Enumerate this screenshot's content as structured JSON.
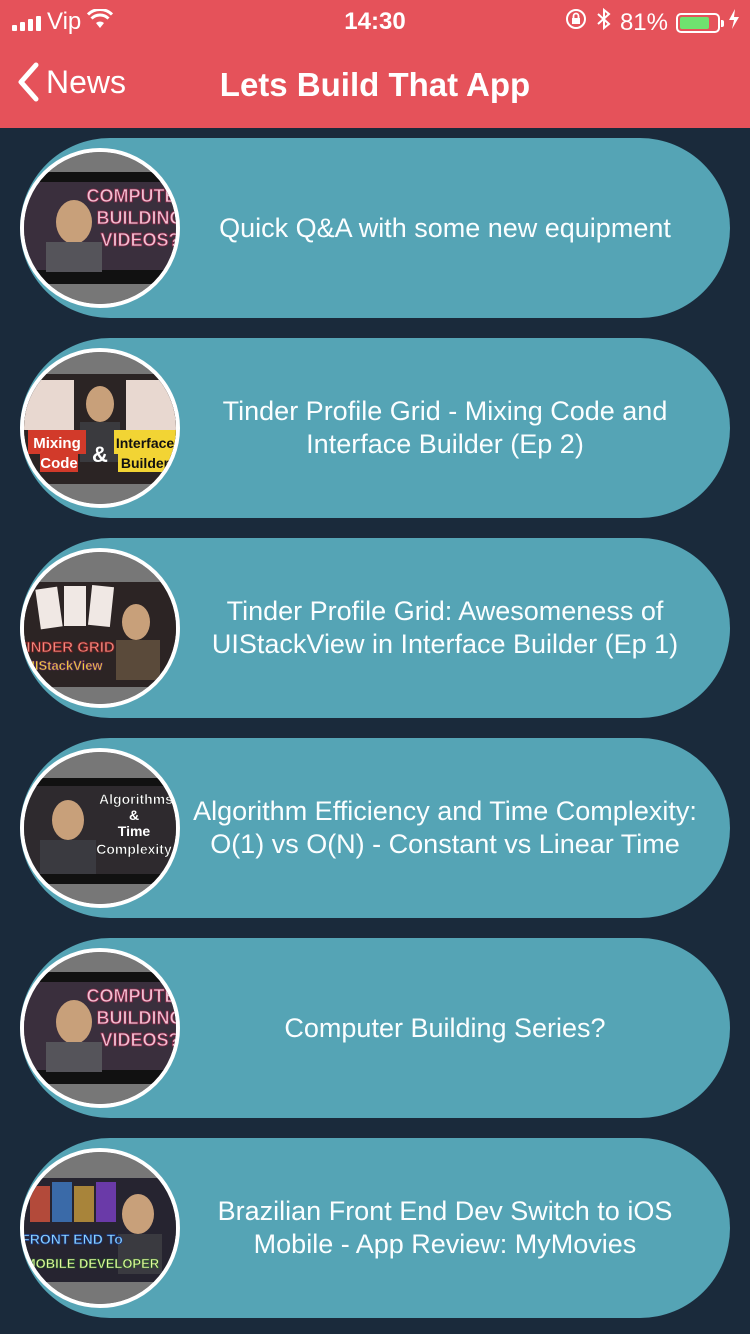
{
  "status_bar": {
    "carrier": "Vip",
    "time": "14:30",
    "battery_percent": "81%",
    "battery_level": 0.81,
    "battery_color": "#6fe26f"
  },
  "nav": {
    "back_label": "News",
    "title": "Lets Build That App",
    "bar_color": "#e5525a"
  },
  "cells": [
    {
      "title": "Quick Q&A with some new equipment",
      "thumb_icon": "computer-building-videos-thumbnail"
    },
    {
      "title": "Tinder Profile Grid - Mixing Code and Interface Builder (Ep 2)",
      "thumb_icon": "mixing-code-interface-builder-thumbnail"
    },
    {
      "title": "Tinder Profile Grid: Awesomeness of UIStackView in Interface Builder (Ep 1)",
      "thumb_icon": "tinder-grid-uistackview-thumbnail"
    },
    {
      "title": "Algorithm Efficiency and Time Complexity: O(1) vs O(N) - Constant vs Linear Time",
      "thumb_icon": "algorithms-time-complexity-thumbnail"
    },
    {
      "title": "Computer Building Series?",
      "thumb_icon": "computer-building-videos-thumbnail"
    },
    {
      "title": "Brazilian Front End Dev Switch to iOS Mobile - App Review: MyMovies",
      "thumb_icon": "front-end-to-mobile-developer-thumbnail"
    }
  ],
  "thumb_captions": {
    "t1": [
      "COMPUTER",
      "BUILDING",
      "VIDEOS?"
    ],
    "t2": [
      "Mixing",
      "Code",
      "&",
      "Interface",
      "Builder"
    ],
    "t3": [
      "TINDER GRID",
      "UIStackView"
    ],
    "t4": [
      "Algorithms",
      "&",
      "Time",
      "Complexity"
    ],
    "t5": [
      "COMPUTER",
      "BUILDING",
      "VIDEOS?"
    ],
    "t6": [
      "FRONT END To",
      "MOBILE DEVELOPER"
    ]
  },
  "colors": {
    "background": "#1a2a3b",
    "cell": "#55a4b5"
  }
}
